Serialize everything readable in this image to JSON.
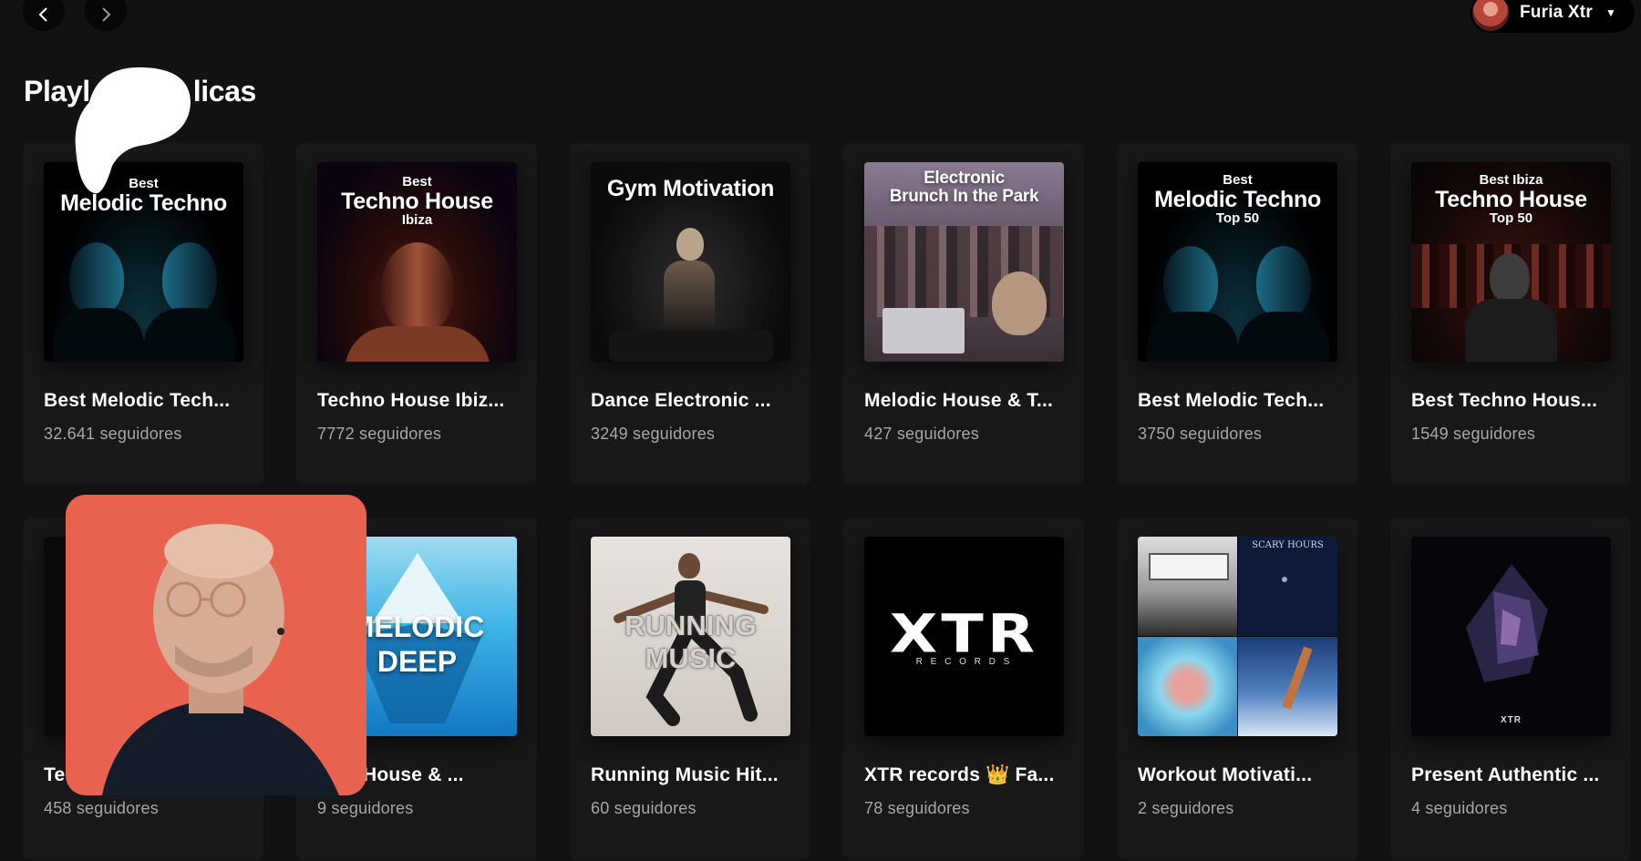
{
  "user": {
    "name": "Furia Xtr"
  },
  "section": {
    "title_start": "Playl",
    "title_end": "licas"
  },
  "row1": [
    {
      "title": "Best Melodic Tech...",
      "followers": "32.641 seguidores",
      "cover": {
        "small_top": "Best",
        "big": "Melodic Techno",
        "small_bottom": ""
      }
    },
    {
      "title": "Techno House Ibiz...",
      "followers": "7772 seguidores",
      "cover": {
        "small_top": "Best",
        "big": "Techno House",
        "small_bottom": "Ibiza"
      }
    },
    {
      "title": "Dance Electronic ...",
      "followers": "3249 seguidores",
      "cover": {
        "big": "Gym Motivation"
      }
    },
    {
      "title": "Melodic House & T...",
      "followers": "427 seguidores",
      "cover": {
        "big": "Electronic",
        "big2": "Brunch In the Park"
      }
    },
    {
      "title": "Best Melodic Tech...",
      "followers": "3750 seguidores",
      "cover": {
        "small_top": "Best",
        "big": "Melodic Techno",
        "small_bottom": "Top 50"
      }
    },
    {
      "title": "Best Techno Hous...",
      "followers": "1549 seguidores",
      "cover": {
        "small_top": "Best Ibiza",
        "big": "Techno House",
        "small_bottom": "Top 50"
      }
    }
  ],
  "row2": [
    {
      "title": "Te",
      "followers": "458 seguidores"
    },
    {
      "title": "odic House & ...",
      "followers": "9 seguidores",
      "cover": {
        "line1": "MELODIC",
        "line2": "DEEP"
      }
    },
    {
      "title": "Running Music Hit...",
      "followers": "60 seguidores",
      "cover": {
        "line1": "RUNNING",
        "line2": "MUSIC"
      }
    },
    {
      "title": "XTR records 👑 Fa...",
      "followers": "78 seguidores",
      "cover": {
        "logo": "XTR",
        "sub": "R E C O R D S"
      }
    },
    {
      "title": "Workout Motivati...",
      "followers": "2 seguidores",
      "cover": {
        "tile_text": "SCARY HOURS"
      }
    },
    {
      "title": "Present Authentic ...",
      "followers": "4 seguidores",
      "cover": {
        "logo": "XTR"
      }
    }
  ]
}
